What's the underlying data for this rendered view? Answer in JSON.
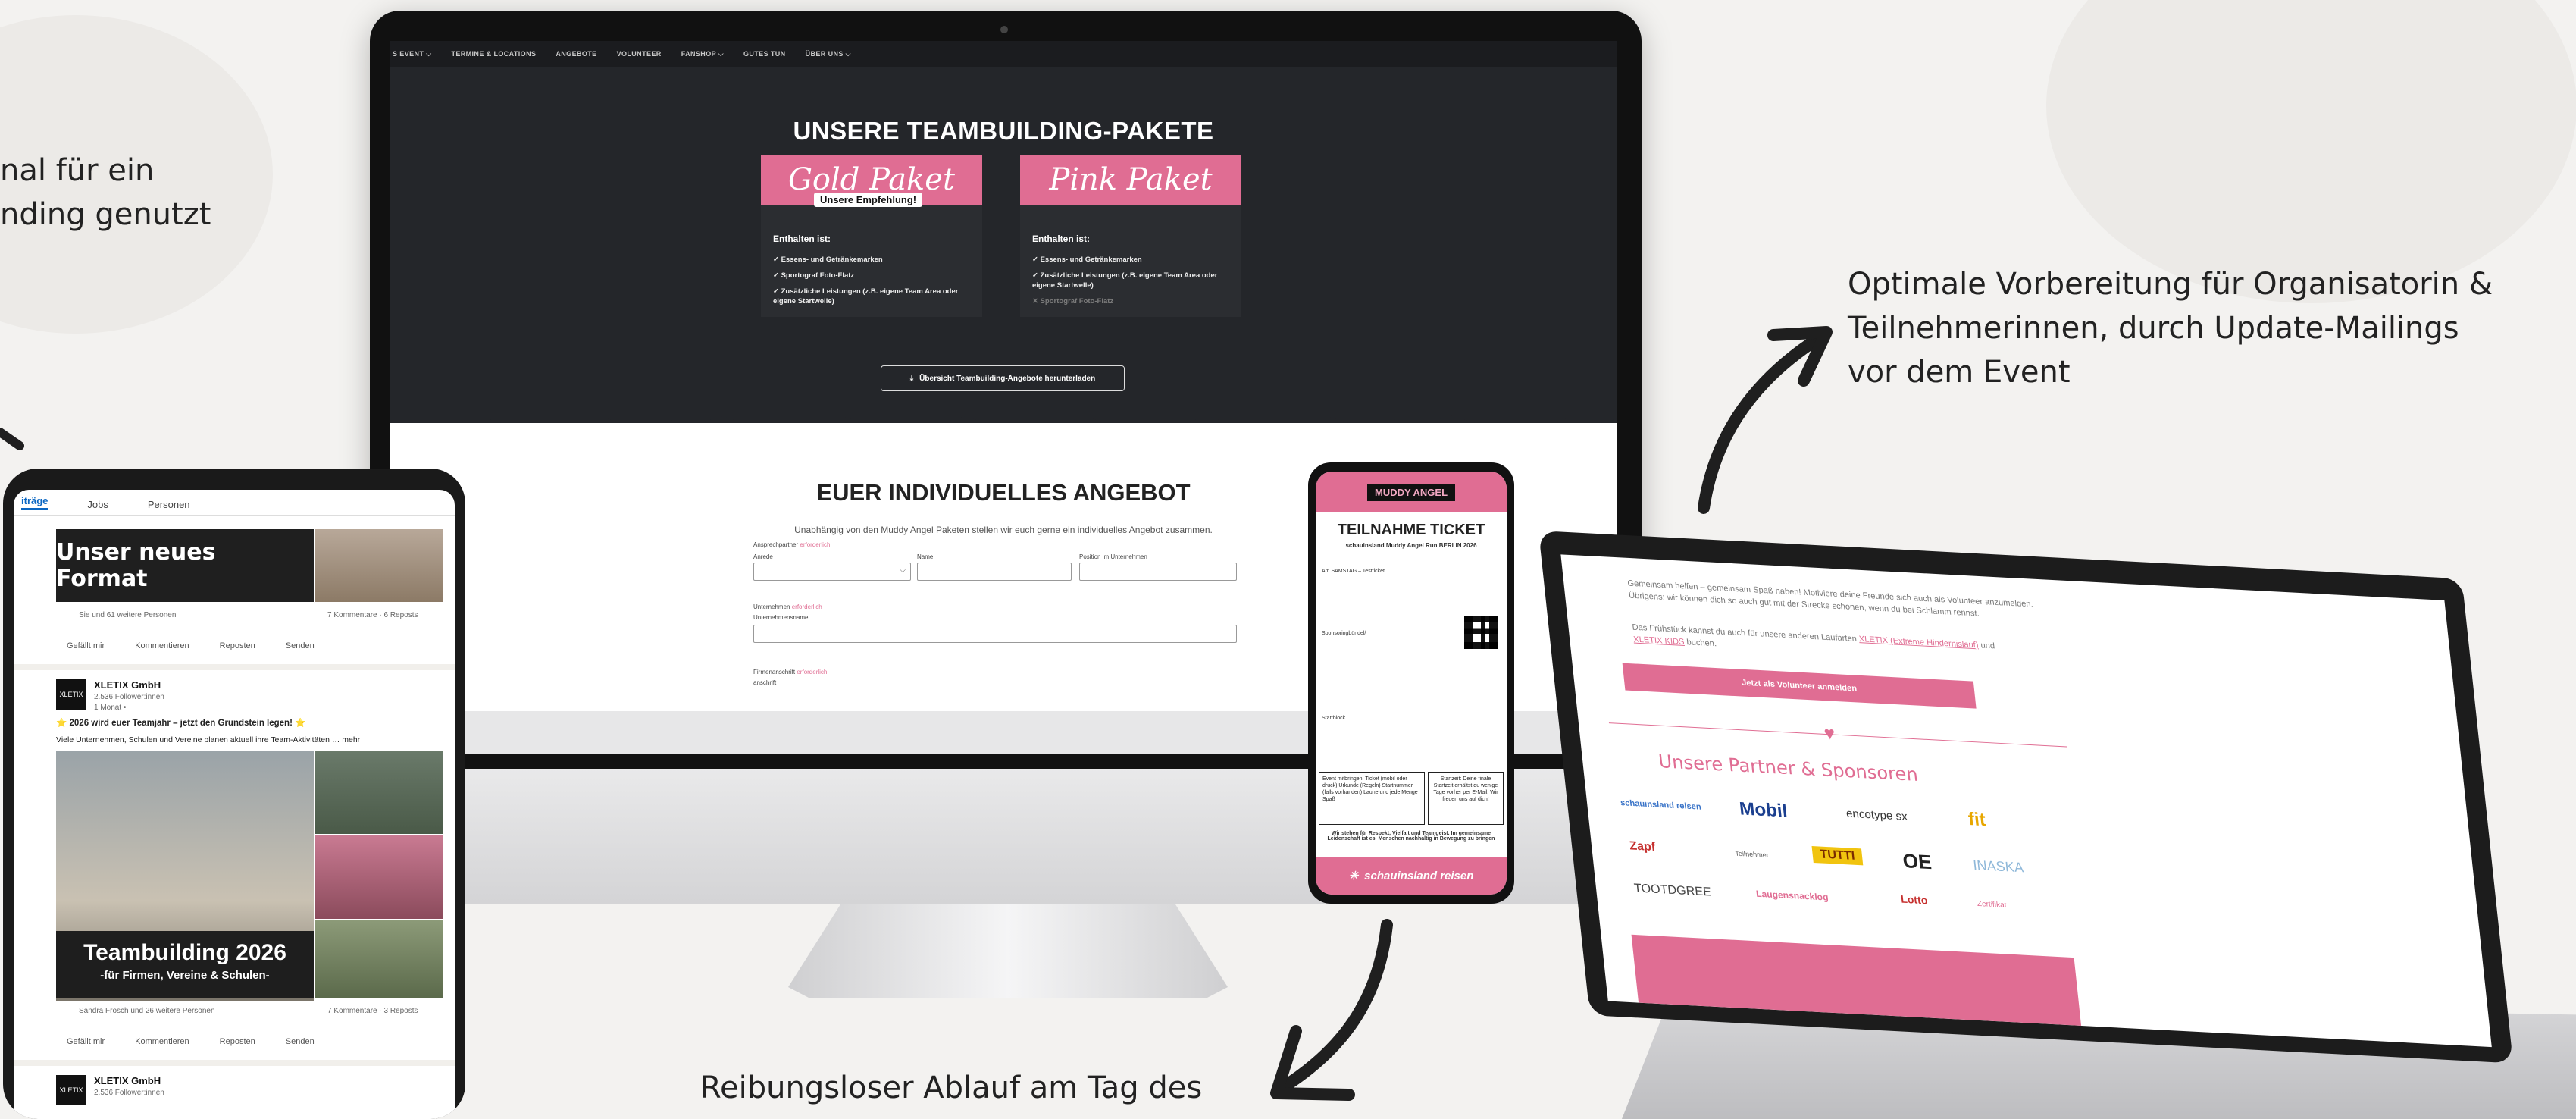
{
  "captions": {
    "left": "nal für ein\nnding genutzt",
    "right": "Optimale Vorbereitung für Organisatorin &\nTeilnehmerinnen, durch Update-Mailings\nvor dem Event",
    "bottom": "Reibungsloser Ablauf am Tag des"
  },
  "monitor": {
    "nav": [
      "S EVENT ⌵",
      "TERMINE & LOCATIONS",
      "ANGEBOTE",
      "VOLUNTEER",
      "FANSHOP ⌵",
      "GUTES TUN",
      "ÜBER UNS ⌵"
    ],
    "title": "UNSERE TEAMBUILDING-PAKETE",
    "gold": {
      "name": "Gold Paket",
      "badge": "Unsere Empfehlung!",
      "contains": "Enthalten ist:",
      "items": [
        "✓  Essens- und Getränkemarken",
        "✓  Sportograf Foto-Flatz",
        "✓  Zusätzliche Leistungen (z.B. eigene Team Area oder eigene Startwelle)"
      ]
    },
    "pink": {
      "name": "Pink Paket",
      "contains": "Enthalten ist:",
      "items": [
        "✓  Essens- und Getränkemarken",
        "✓  Zusätzliche Leistungen (z.B. eigene Team Area oder eigene Startwelle)",
        "✕  Sportograf Foto-Flatz"
      ]
    },
    "download": "Übersicht Teambuilding-Angebote herunterladen",
    "angebot_title": "EUER INDIVIDUELLES ANGEBOT",
    "angebot_sub": "Unabhängig von den Muddy Angel Paketen stellen wir euch gerne ein individuelles Angebot zusammen.",
    "form": {
      "ansprech": "Ansprechpartner",
      "required": "erforderlich",
      "anrede": "Anrede",
      "name": "Name",
      "position": "Position im Unternehmen",
      "unternehmen": "Unternehmen",
      "unternehmensname": "Unternehmensname",
      "firmenanschrift": "Firmenanschrift",
      "anschrift": "anschrift"
    }
  },
  "tablet": {
    "tabs": [
      "iträge",
      "Jobs",
      "Personen"
    ],
    "post1_img_text": "Unser neues Format",
    "post1_reactions": "Sie und 61 weitere Personen",
    "post1_comments": "7 Kommentare · 6 Reposts",
    "actions": [
      "Gefällt mir",
      "Kommentieren",
      "Reposten",
      "Senden"
    ],
    "author": "XLETIX GmbH",
    "followers": "2.536 Follower:innen",
    "time": "1 Monat • ",
    "headline": "⭐ 2026 wird euer Teamjahr – jetzt den Grundstein legen! ⭐",
    "body": "Viele Unternehmen, Schulen und Vereine planen aktuell ihre Team-Aktivitäten … mehr",
    "banner_title": "Teambuilding 2026",
    "banner_sub": "-für Firmen, Vereine & Schulen-",
    "post2_reactions": "Sandra Frosch und 26 weitere Personen",
    "post2_comments": "7 Kommentare · 3 Reposts",
    "author2": "XLETIX GmbH",
    "followers2": "2.536 Follower:innen"
  },
  "phone": {
    "brand": "MUDDY ANGEL",
    "title": "TEILNAHME TICKET",
    "subtitle": "schauinsland Muddy Angel Run BERLIN 2026",
    "line1": "Am SAMSTAG – Testticket",
    "line2": "Sponsoringbündel/",
    "line3": "Startblock",
    "box1": "Event mitbringen: Ticket (mobil oder druck) Urkunde (Regeln) Startnummer (falls vorhanden) Laune und jede Menge Spaß",
    "box2": "Startzeit: Deine finale Startzeit erhältst du wenige Tage vorher per E-Mail. Wir freuen uns auf dich!",
    "note": "Wir stehen für Respekt, Vielfalt und Teamgeist. Im gemeinsame Leidenschaft ist es, Menschen nachhaltig in Bewegung zu bringen",
    "footer": "schauinsland reisen"
  },
  "laptop": {
    "text1": "Gemeinsam helfen – gemeinsam Spaß haben! Motiviere deine Freunde sich auch als Volunteer anzumelden. Übrigens: wir können dich so auch gut mit der Strecke schonen, wenn du bei Schlamm rennst.",
    "text2a": "Das Frühstück kannst du auch für unsere anderen Laufarten",
    "link1": "XLETIX (Extreme Hindernislauf)",
    "text2b": "und",
    "link2": "XLETIX KIDS",
    "text2c": "buchen.",
    "button": "Jetzt als Volunteer anmelden",
    "heading": "Unsere Partner & Sponsoren",
    "sponsors": [
      "schauinsland reisen",
      "Mobil",
      "encotype sx",
      "fit",
      "Zapf",
      "Teilnehmer",
      "TUTTI",
      "OE",
      "INASKA",
      "TOOTDGREE",
      "Laugensnacklog",
      "Lotto",
      "Zertifikat"
    ]
  }
}
